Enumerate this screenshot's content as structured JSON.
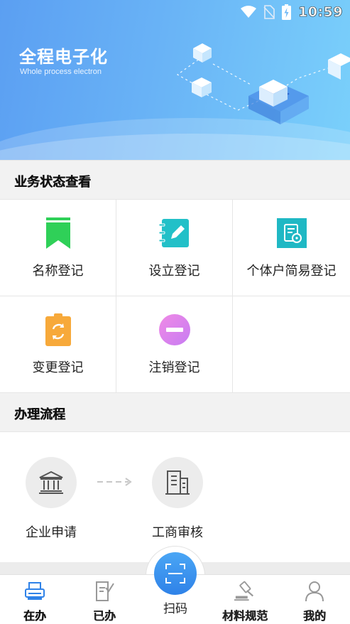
{
  "status_bar": {
    "time": "10:59"
  },
  "banner": {
    "title": "全程电子化",
    "subtitle": "Whole process electron"
  },
  "business_status": {
    "header": "业务状态查看",
    "items": [
      {
        "label": "名称登记",
        "icon": "bookmark-icon",
        "color": "#2fd058"
      },
      {
        "label": "设立登记",
        "icon": "notebook-edit-icon",
        "color": "#22c0c8"
      },
      {
        "label": "个体户简易登记",
        "icon": "document-settings-icon",
        "color": "#1fb8c4"
      },
      {
        "label": "变更登记",
        "icon": "clipboard-refresh-icon",
        "color": "#f7a93a"
      },
      {
        "label": "注销登记",
        "icon": "minus-circle-icon",
        "color": "#e07af0"
      }
    ]
  },
  "process": {
    "header": "办理流程",
    "steps": [
      {
        "label": "企业申请",
        "icon": "bank-building-icon"
      },
      {
        "label": "工商审核",
        "icon": "office-building-icon"
      }
    ]
  },
  "tabbar": {
    "tabs": [
      {
        "label": "在办",
        "icon": "printer-icon",
        "active": true
      },
      {
        "label": "已办",
        "icon": "checked-doc-icon",
        "active": false
      },
      {
        "label": "扫码",
        "icon": "scan-icon",
        "active": false
      },
      {
        "label": "材料规范",
        "icon": "gavel-icon",
        "active": false
      },
      {
        "label": "我的",
        "icon": "person-icon",
        "active": false
      }
    ],
    "accent": "#2f82e8"
  }
}
